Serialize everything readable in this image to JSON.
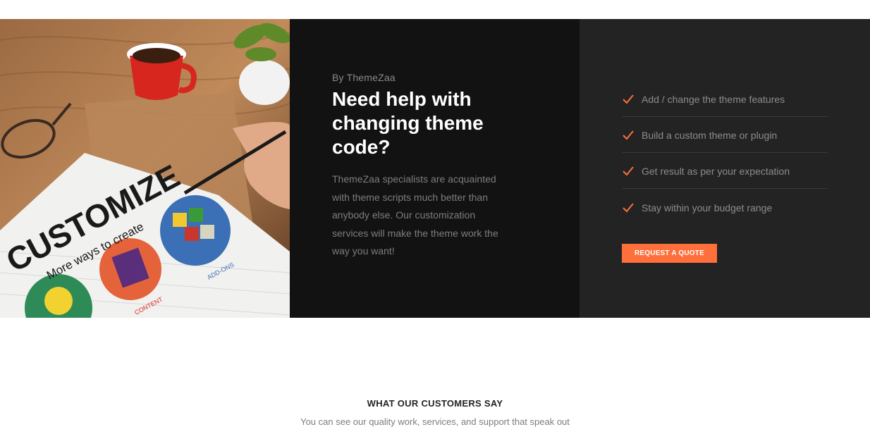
{
  "promo": {
    "image_alt": "Notebook with customize drawing",
    "image_text": {
      "title": "CUSTOMIZE",
      "subtitle": "More ways to create",
      "label_content": "CONTENT",
      "label_addons": "ADD-ONS"
    },
    "byline": "By ThemeZaa",
    "headline": "Need help with changing theme code?",
    "description": "ThemeZaa specialists are acquainted with theme scripts much better than anybody else. Our customization services will make the theme work the way you want!",
    "features": [
      {
        "label": "Add / change the theme features",
        "icon": "check-icon"
      },
      {
        "label": "Build a custom theme or plugin",
        "icon": "check-icon"
      },
      {
        "label": "Get result as per your expectation",
        "icon": "check-icon"
      },
      {
        "label": "Stay within your budget range",
        "icon": "check-icon"
      }
    ],
    "cta_label": "REQUEST A QUOTE"
  },
  "testimonials": {
    "heading": "WHAT OUR CUSTOMERS SAY",
    "subheading": "You can see our quality work, services, and support that speak out"
  },
  "colors": {
    "accent": "#ff6f3b",
    "dark_panel": "#121212",
    "mid_panel": "#232323"
  }
}
